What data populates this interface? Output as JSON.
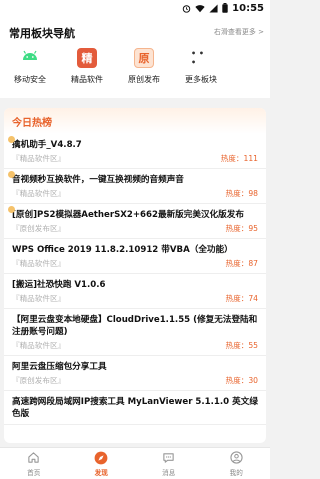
{
  "status": {
    "time": "10:55"
  },
  "nav": {
    "title": "常用板块导航",
    "hint": "右滑查看更多 >",
    "items": [
      {
        "label": "移动安全",
        "icon": "android-icon",
        "color": "#3ddc84"
      },
      {
        "label": "精品软件",
        "icon": "premium-software-icon",
        "glyph": "精",
        "color": "#e35b3b"
      },
      {
        "label": "原创发布",
        "icon": "original-release-icon",
        "glyph": "原",
        "color": "#f08a4b"
      },
      {
        "label": "更多板块",
        "icon": "more-icon",
        "glyph": "• • •",
        "color": "#333333"
      }
    ]
  },
  "hot": {
    "title": "今日热榜",
    "heat_prefix": "热度：",
    "items": [
      {
        "title": "擒机助手_V4.8.7",
        "tag": "『精品软件区』",
        "heat": "111"
      },
      {
        "title": "音视频秒互换软件，一键互换视频的音频声音",
        "tag": "『精品软件区』",
        "heat": "98"
      },
      {
        "title": "[原创]PS2模拟器AetherSX2+662最新版完美汉化版发布",
        "tag": "『原创发布区』",
        "heat": "95"
      },
      {
        "title": "WPS Office 2019 11.8.2.10912 带VBA（全功能）",
        "tag": "『精品软件区』",
        "heat": "87"
      },
      {
        "title": "[搬运]社恐快跑 V1.0.6",
        "tag": "『精品软件区』",
        "heat": "74"
      },
      {
        "title": "【阿里云盘变本地硬盘】CloudDrive1.1.55 (修复无法登陆和注册账号问题)",
        "tag": "『精品软件区』",
        "heat": "55"
      },
      {
        "title": "阿里云盘压缩包分享工具",
        "tag": "『原创发布区』",
        "heat": "30"
      },
      {
        "title": "高速跨网段局域网IP搜索工具 MyLanViewer 5.1.1.0 英文绿色版",
        "tag": "",
        "heat": ""
      }
    ]
  },
  "tabs": [
    {
      "label": "首页",
      "icon": "home-icon"
    },
    {
      "label": "发现",
      "icon": "compass-icon",
      "active": true
    },
    {
      "label": "消息",
      "icon": "message-icon"
    },
    {
      "label": "我的",
      "icon": "user-icon"
    }
  ],
  "colors": {
    "accent": "#e8632c",
    "tag_gray": "#b0b0b0"
  }
}
